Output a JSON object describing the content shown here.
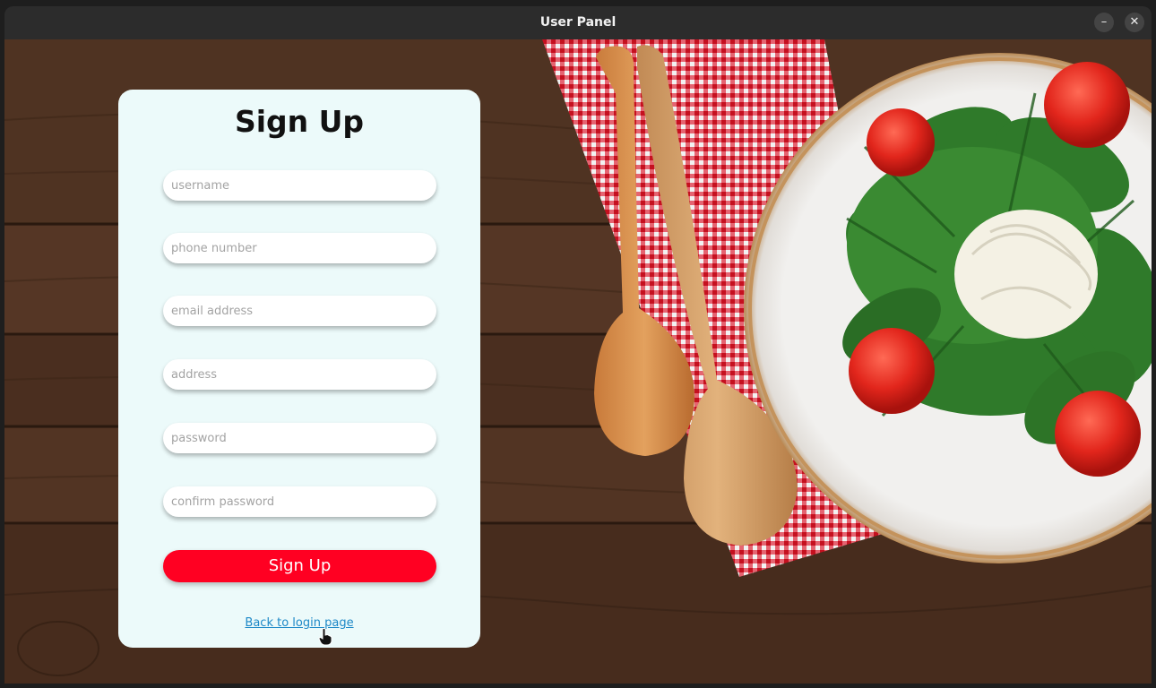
{
  "window": {
    "title": "User Panel",
    "minimize_glyph": "–",
    "close_glyph": "✕"
  },
  "form": {
    "heading": "Sign Up",
    "fields": [
      {
        "placeholder": "username"
      },
      {
        "placeholder": "phone number"
      },
      {
        "placeholder": "email address"
      },
      {
        "placeholder": "address"
      },
      {
        "placeholder": "password"
      },
      {
        "placeholder": "confirm password"
      }
    ],
    "submit_label": "Sign Up",
    "back_link": "Back to login page"
  },
  "colors": {
    "card_bg": "#ecfafa",
    "submit_bg": "#ff0022",
    "link": "#1d88c7",
    "wood": "#4a2f1f"
  },
  "icons": {
    "minimize": "minimize-icon",
    "close": "close-icon",
    "cursor": "hand-pointer-icon"
  }
}
